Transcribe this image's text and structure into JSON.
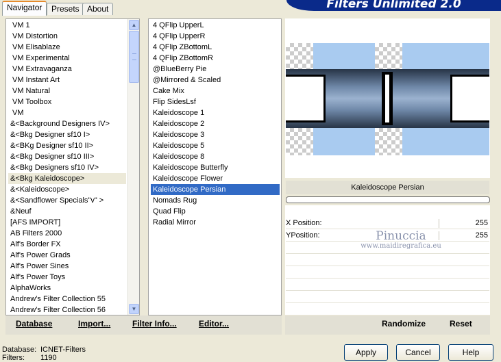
{
  "tabs": [
    "Navigator",
    "Presets",
    "About"
  ],
  "banner": "Filters Unlimited 2.0",
  "categories": [
    "VM 1",
    "VM Distortion",
    "VM Elisablaze",
    "VM Experimental",
    "VM Extravaganza",
    "VM Instant Art",
    "VM Natural",
    "VM Toolbox",
    "VM",
    "&<Background Designers IV>",
    "&<Bkg Designer sf10 I>",
    "&<BKg Designer sf10 II>",
    "&<Bkg Designer sf10 III>",
    "&<Bkg Designers sf10 IV>",
    "&<Bkg Kaleidoscope>",
    "&<Kaleidoscope>",
    "&<Sandflower Specials\"v\" >",
    "&Neuf",
    "[AFS IMPORT]",
    "AB Filters 2000",
    "Alf's Border FX",
    "Alf's Power Grads",
    "Alf's Power Sines",
    "Alf's Power Toys",
    "AlphaWorks",
    "Andrew's Filter Collection 55",
    "Andrew's Filter Collection 56"
  ],
  "selected_category": "&<Bkg Kaleidoscope>",
  "filters": [
    "4 QFlip UpperL",
    "4 QFlip UpperR",
    "4 QFlip ZBottomL",
    "4 QFlip ZBottomR",
    "@BlueBerry Pie",
    "@Mirrored & Scaled",
    "Cake Mix",
    "Flip SidesLsf",
    "Kaleidoscope 1",
    "Kaleidoscope 2",
    "Kaleidoscope 3",
    "Kaleidoscope 5",
    "Kaleidoscope 8",
    "Kaleidoscope Butterfly",
    "Kaleidoscope Flower",
    "Kaleidoscope Persian",
    "Nomads Rug",
    "Quad Flip",
    "Radial Mirror"
  ],
  "selected_filter": "Kaleidoscope Persian",
  "toolbar": {
    "database": "Database",
    "import": "Import...",
    "filter_info": "Filter Info...",
    "editor": "Editor...",
    "randomize": "Randomize",
    "reset": "Reset"
  },
  "preview_label": "Kaleidoscope Persian",
  "params": [
    {
      "label": "X Position:",
      "value": "255"
    },
    {
      "label": "YPosition:",
      "value": "255"
    }
  ],
  "watermark": {
    "line1": "Pinuccia",
    "line2": "www.maidiregrafica.eu"
  },
  "status": {
    "database_label": "Database:",
    "database_value": "ICNET-Filters",
    "filters_label": "Filters:",
    "filters_value": "1190"
  },
  "buttons": {
    "apply": "Apply",
    "cancel": "Cancel",
    "help": "Help"
  },
  "colors": {
    "selection": "#316ac5",
    "banner": "#0a2a8a"
  }
}
